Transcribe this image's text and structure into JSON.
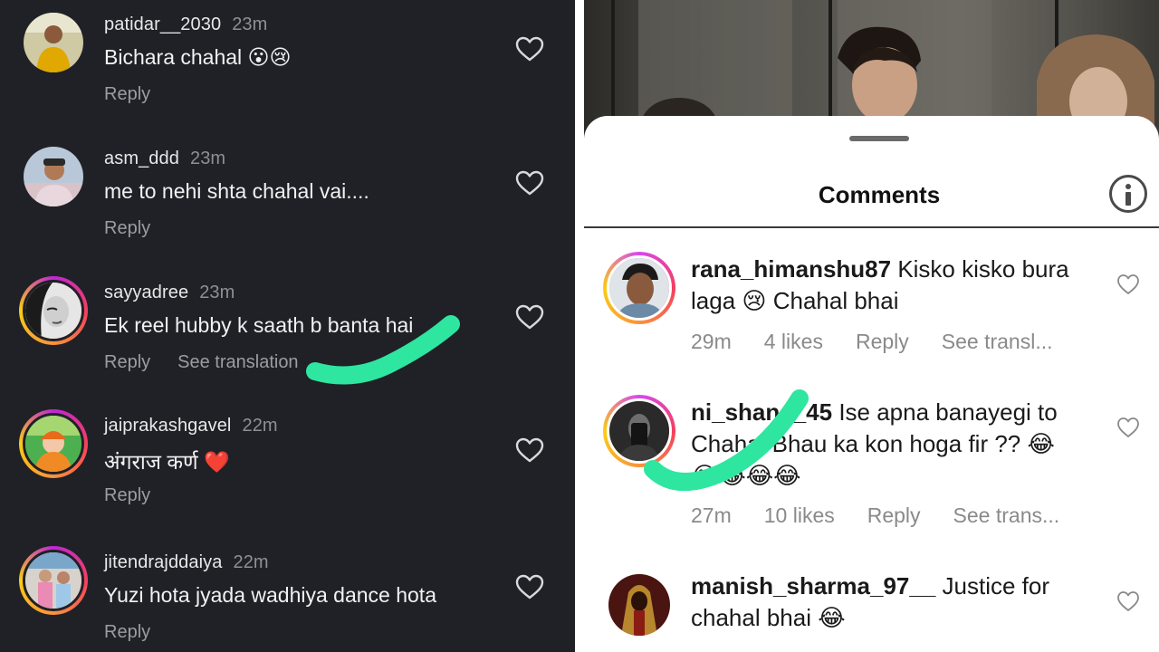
{
  "left_comments": [
    {
      "username": "patidar__2030",
      "time": "23m",
      "text": "Bichara chahal 😮😢",
      "reply": "Reply",
      "translate": ""
    },
    {
      "username": "asm_ddd",
      "time": "23m",
      "text": "me to nehi shta chahal vai....",
      "reply": "Reply",
      "translate": ""
    },
    {
      "username": "sayyadree",
      "time": "23m",
      "text": "Ek reel hubby k saath b banta hai",
      "reply": "Reply",
      "translate": "See translation"
    },
    {
      "username": "jaiprakashgavel",
      "time": "22m",
      "text": "अंगराज कर्ण ❤️",
      "reply": "Reply",
      "translate": ""
    },
    {
      "username": "jitendrajddaiya",
      "time": "22m",
      "text": "Yuzi hota jyada wadhiya dance hota",
      "reply": "Reply",
      "translate": ""
    }
  ],
  "right": {
    "title": "Comments",
    "comments": [
      {
        "username": "rana_himanshu87",
        "text_line1": " Kisko kisko bura",
        "text_line2": "laga 😢 Chahal bhai",
        "text_line3": "",
        "time": "29m",
        "likes": "4 likes",
        "reply": "Reply",
        "translate": "See transl..."
      },
      {
        "username": "ni_shan__45",
        "text_line1": " Ise apna banayegi to",
        "text_line2": "Chahal Bhau ka kon hoga fir ?? 😂",
        "text_line3": "😂😂😂😂",
        "time": "27m",
        "likes": "10 likes",
        "reply": "Reply",
        "translate": "See trans..."
      },
      {
        "username": "manish_sharma_97__",
        "text_line1": " Justice for",
        "text_line2": "chahal bhai 😂",
        "text_line3": "",
        "time": "",
        "likes": "",
        "reply": "",
        "translate": ""
      }
    ]
  },
  "colors": {
    "left_bg": "#1f2126",
    "highlight_mark": "#2ee6a0",
    "story_ring": "#d946ef"
  },
  "icons": {
    "like": "heart-outline-icon",
    "info": "info-circle-icon"
  }
}
